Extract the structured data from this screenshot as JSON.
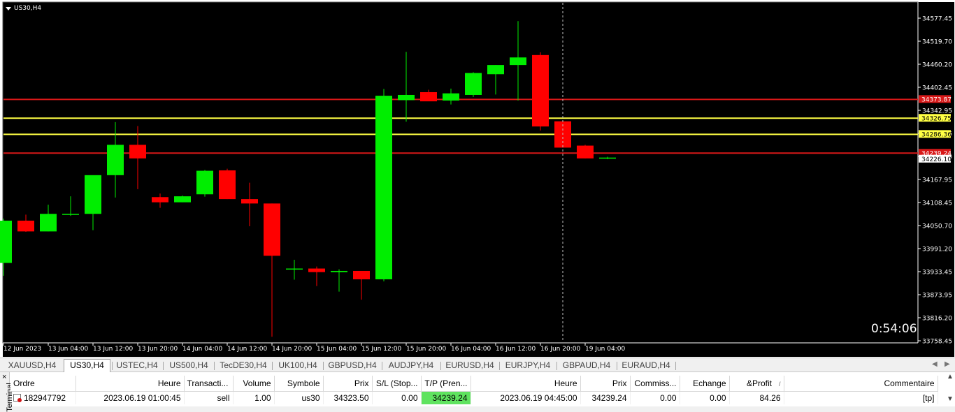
{
  "chart": {
    "title": "US30,H4",
    "timer": "0:54:06",
    "colors": {
      "background": "#000000",
      "bull": "#00ee00",
      "bear": "#ff0000",
      "axis": "#ffffff",
      "red_line": "#d81818",
      "yellow_line": "#ffff44",
      "crosshair": "#c0c0c0"
    },
    "price_labels": [
      "34577.45",
      "34519.70",
      "34460.20",
      "34402.45",
      "34342.95",
      "34286.36",
      "34226.10",
      "34167.95",
      "34108.45",
      "34050.70",
      "33991.20",
      "33933.45",
      "33873.95",
      "33816.20",
      "33758.45"
    ],
    "time_labels": [
      "12 Jun 2023",
      "13 Jun 04:00",
      "13 Jun 12:00",
      "13 Jun 20:00",
      "14 Jun 04:00",
      "14 Jun 12:00",
      "14 Jun 20:00",
      "15 Jun 04:00",
      "15 Jun 12:00",
      "15 Jun 20:00",
      "16 Jun 04:00",
      "16 Jun 12:00",
      "16 Jun 20:00",
      "19 Jun 04:00"
    ],
    "level_lines": [
      {
        "price": 34373.87,
        "label": "34373.87",
        "color": "#d81818",
        "tag_bg": "#d81818",
        "tag_fg": "#ffffff"
      },
      {
        "price": 34326.75,
        "label": "34326.75",
        "color": "#ffff44",
        "tag_bg": "#ffff44",
        "tag_fg": "#000000"
      },
      {
        "price": 34286.36,
        "label": "34286.36",
        "color": "#ffff44",
        "tag_bg": "#ffff44",
        "tag_fg": "#000000"
      },
      {
        "price": 34239.24,
        "label": "34239.24",
        "color": "#d81818",
        "tag_bg": "#d81818",
        "tag_fg": "#ffffff"
      }
    ],
    "current_price": {
      "price": 34226.1,
      "label": "34226.10"
    },
    "candles": [
      {
        "o": 33964,
        "h": 34075,
        "l": 33932,
        "c": 34070
      },
      {
        "o": 34070,
        "h": 34085,
        "l": 34042,
        "c": 34043
      },
      {
        "o": 34043,
        "h": 34110,
        "l": 34043,
        "c": 34087
      },
      {
        "o": 34085,
        "h": 34131,
        "l": 34082,
        "c": 34087
      },
      {
        "o": 34087,
        "h": 34183,
        "l": 34046,
        "c": 34184
      },
      {
        "o": 34184,
        "h": 34317,
        "l": 34128,
        "c": 34260
      },
      {
        "o": 34260,
        "h": 34307,
        "l": 34149,
        "c": 34226
      },
      {
        "o": 34129,
        "h": 34138,
        "l": 34102,
        "c": 34116
      },
      {
        "o": 34116,
        "h": 34133,
        "l": 34116,
        "c": 34131
      },
      {
        "o": 34136,
        "h": 34197,
        "l": 34130,
        "c": 34195
      },
      {
        "o": 34196,
        "h": 34200,
        "l": 34124,
        "c": 34124
      },
      {
        "o": 34124,
        "h": 34165,
        "l": 34056,
        "c": 34113
      },
      {
        "o": 34113,
        "h": 34113,
        "l": 33779,
        "c": 33982
      },
      {
        "o": 33950,
        "h": 33972,
        "l": 33922,
        "c": 33950
      },
      {
        "o": 33950,
        "h": 33955,
        "l": 33906,
        "c": 33941
      },
      {
        "o": 33941,
        "h": 33948,
        "l": 33892,
        "c": 33944
      },
      {
        "o": 33944,
        "h": 33944,
        "l": 33872,
        "c": 33923
      },
      {
        "o": 33923,
        "h": 34400,
        "l": 33918,
        "c": 34383
      },
      {
        "o": 34372,
        "h": 34493,
        "l": 34318,
        "c": 34385
      },
      {
        "o": 34392,
        "h": 34398,
        "l": 34370,
        "c": 34369
      },
      {
        "o": 34371,
        "h": 34401,
        "l": 34361,
        "c": 34389
      },
      {
        "o": 34385,
        "h": 34442,
        "l": 34380,
        "c": 34440
      },
      {
        "o": 34437,
        "h": 34460,
        "l": 34386,
        "c": 34460
      },
      {
        "o": 34460,
        "h": 34570,
        "l": 34371,
        "c": 34479
      },
      {
        "o": 34485,
        "h": 34492,
        "l": 34296,
        "c": 34306
      },
      {
        "o": 34319,
        "h": 34319,
        "l": 34253,
        "c": 34253
      },
      {
        "o": 34258,
        "h": 34260,
        "l": 34226,
        "c": 34226
      },
      {
        "o": 34226,
        "h": 34230,
        "l": 34224,
        "c": 34228
      }
    ]
  },
  "tabs": [
    "XAUUSD,H4",
    "US30,H4",
    "USTEC,H4",
    "US500,H4",
    "TecDE30,H4",
    "UK100,H4",
    "GBPUSD,H4",
    "AUDJPY,H4",
    "EURUSD,H4",
    "EURJPY,H4",
    "GBPAUD,H4",
    "EURAUD,H4"
  ],
  "active_tab": "US30,H4",
  "terminal": {
    "side_label": "Terminal",
    "close": "×",
    "columns": [
      "Ordre",
      "Heure",
      "Transacti...",
      "Volume",
      "Symbole",
      "Prix",
      "S/L (Stop...",
      "T/P (Pren...",
      "Heure",
      "Prix",
      "Commiss...",
      "Echange",
      "&Profit",
      "Commentaire"
    ],
    "profit_sort_icon": "/",
    "row": {
      "order": "182947792",
      "open_time": "2023.06.19 01:00:45",
      "type": "sell",
      "volume": "1.00",
      "symbol": "us30",
      "open_price": "34323.50",
      "sl": "0.00",
      "tp": "34239.24",
      "close_time": "2023.06.19 04:45:00",
      "close_price": "34239.24",
      "commission": "0.00",
      "swap": "0.00",
      "profit": "84.26",
      "comment": "[tp]"
    }
  }
}
